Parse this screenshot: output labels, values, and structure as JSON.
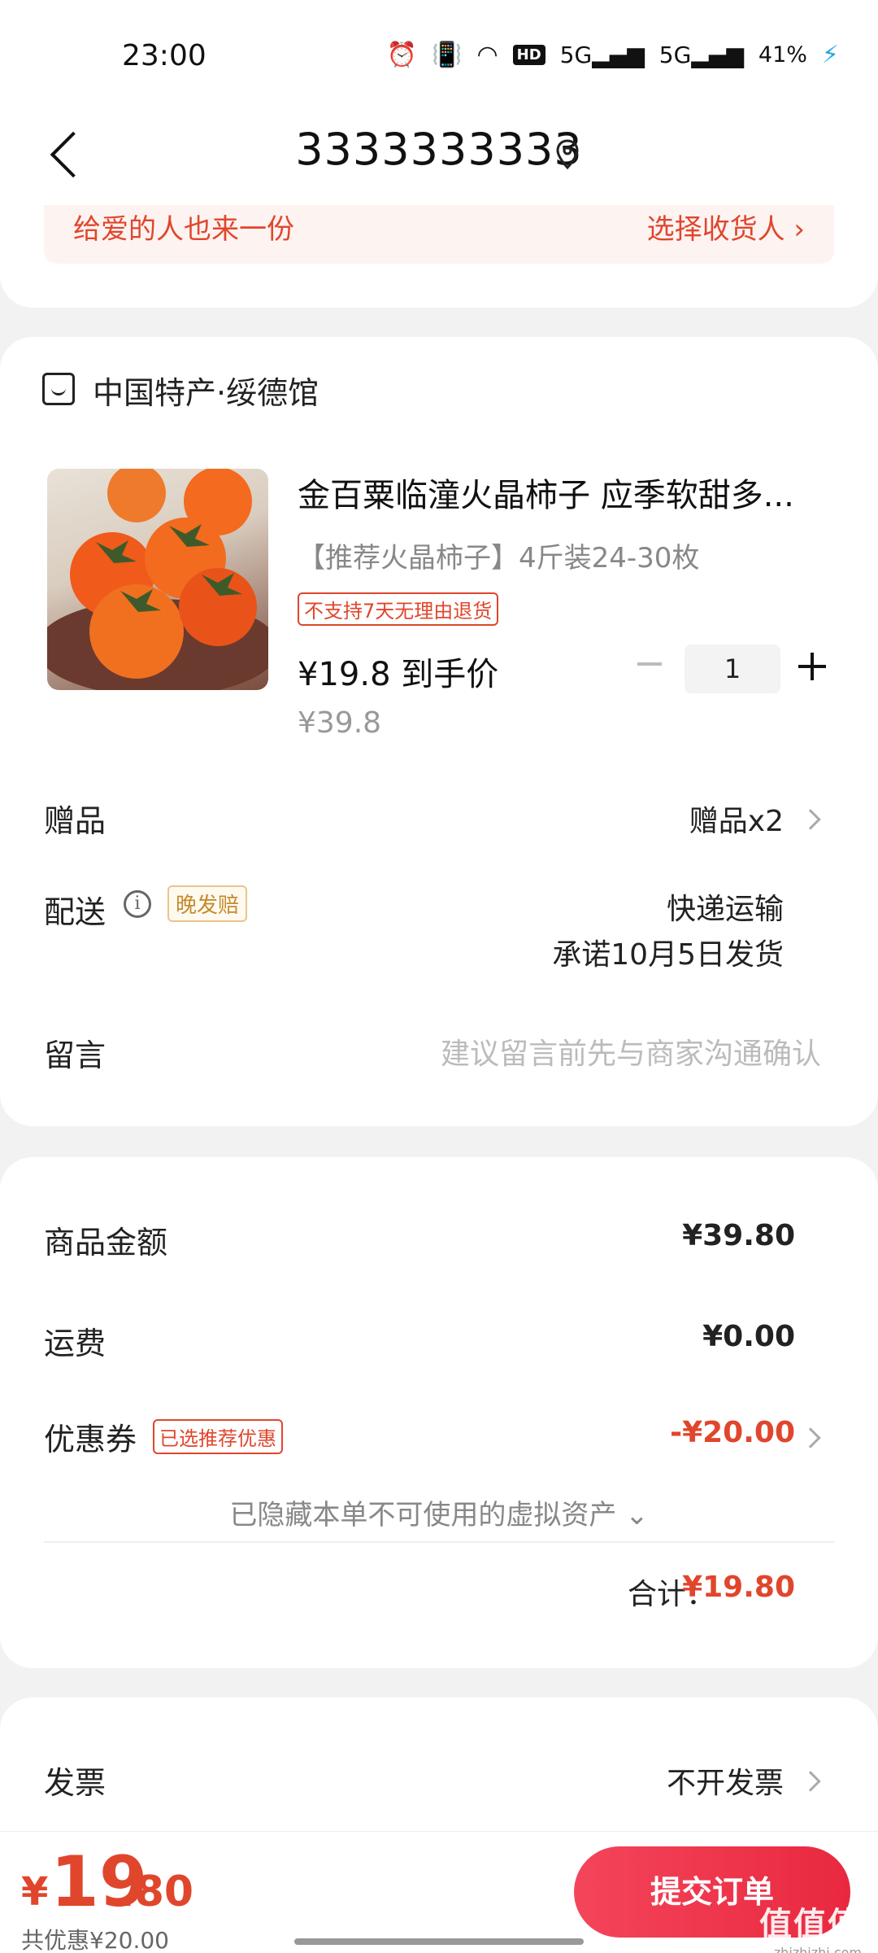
{
  "status_bar": {
    "time": "23:00",
    "hd": "HD",
    "signal_5g_1": "5G",
    "signal_5g_2": "5G",
    "battery": "41%"
  },
  "header": {
    "title": "3333333333"
  },
  "gift_banner": {
    "text": "给爱的人也来一份",
    "link": "选择收货人 ›"
  },
  "shop": {
    "name": "中国特产·绥德馆"
  },
  "product": {
    "title": "金百粟临潼火晶柿子 应季软甜多...",
    "spec": "【推荐火晶柿子】4斤装24-30枚",
    "tag": "不支持7天无理由退货",
    "price": "¥19.8 到手价",
    "original_price": "¥39.8",
    "quantity": "1"
  },
  "rows": {
    "gift_label": "赠品",
    "gift_value": "赠品x2",
    "delivery_label": "配送",
    "delivery_badge": "晚发赔",
    "delivery_method": "快递运输",
    "delivery_promise": "承诺10月5日发货",
    "note_label": "留言",
    "note_placeholder": "建议留言前先与商家沟通确认"
  },
  "amount": {
    "goods_label": "商品金额",
    "goods_value": "¥39.80",
    "shipping_label": "运费",
    "shipping_value": "¥0.00",
    "coupon_label": "优惠券",
    "coupon_badge": "已选推荐优惠",
    "coupon_value": "-¥20.00",
    "hidden_note": "已隐藏本单不可使用的虚拟资产 ⌄",
    "total_label": "合计：",
    "total_value": "¥19.80"
  },
  "invoice": {
    "label": "发票",
    "value": "不开发票"
  },
  "bottom": {
    "yen": "¥",
    "price_int": "19",
    "price_dec": ".80",
    "saved": "共优惠¥20.00",
    "submit": "提交订单"
  },
  "watermark": {
    "main": "值值值",
    "sub": "zhizhizhi.com"
  },
  "colors": {
    "accent": "#e0462c",
    "button": "#ef3449",
    "badge_gold": "#c58b2c"
  }
}
